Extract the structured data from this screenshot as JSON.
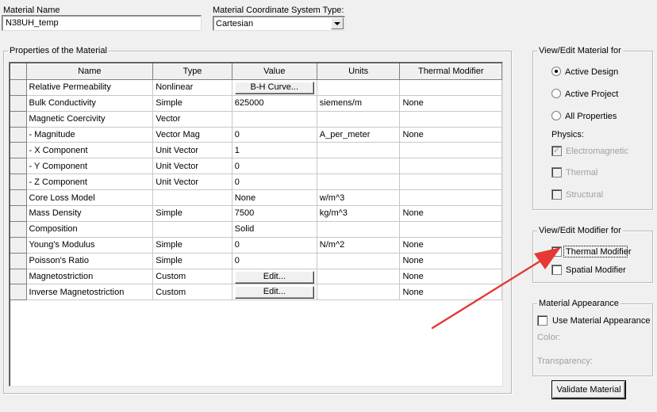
{
  "material_name": {
    "label": "Material Name",
    "value": "N38UH_temp"
  },
  "coord_system": {
    "label": "Material Coordinate System Type:",
    "value": "Cartesian"
  },
  "properties": {
    "title": "Properties of the Material",
    "columns": [
      "Name",
      "Type",
      "Value",
      "Units",
      "Thermal Modifier"
    ],
    "rows": [
      {
        "name": "Relative Permeability",
        "type": "Nonlinear",
        "value": "B-H Curve...",
        "value_is_button": true,
        "units": "",
        "thermal": ""
      },
      {
        "name": "Bulk Conductivity",
        "type": "Simple",
        "value": "625000",
        "value_is_button": false,
        "units": "siemens/m",
        "thermal": "None"
      },
      {
        "name": "Magnetic Coercivity",
        "type": "Vector",
        "value": "",
        "value_is_button": false,
        "units": "",
        "thermal": ""
      },
      {
        "name": "- Magnitude",
        "type": "Vector Mag",
        "value": "0",
        "value_is_button": false,
        "units": "A_per_meter",
        "thermal": "None"
      },
      {
        "name": "- X Component",
        "type": "Unit Vector",
        "value": "1",
        "value_is_button": false,
        "units": "",
        "thermal": ""
      },
      {
        "name": "- Y Component",
        "type": "Unit Vector",
        "value": "0",
        "value_is_button": false,
        "units": "",
        "thermal": ""
      },
      {
        "name": "- Z Component",
        "type": "Unit Vector",
        "value": "0",
        "value_is_button": false,
        "units": "",
        "thermal": ""
      },
      {
        "name": "Core Loss Model",
        "type": "",
        "value": "None",
        "value_is_button": false,
        "units": "w/m^3",
        "thermal": ""
      },
      {
        "name": "Mass Density",
        "type": "Simple",
        "value": "7500",
        "value_is_button": false,
        "units": "kg/m^3",
        "thermal": "None"
      },
      {
        "name": "Composition",
        "type": "",
        "value": "Solid",
        "value_is_button": false,
        "units": "",
        "thermal": ""
      },
      {
        "name": "Young's Modulus",
        "type": "Simple",
        "value": "0",
        "value_is_button": false,
        "units": "N/m^2",
        "thermal": "None"
      },
      {
        "name": "Poisson's Ratio",
        "type": "Simple",
        "value": "0",
        "value_is_button": false,
        "units": "",
        "thermal": "None"
      },
      {
        "name": "Magnetostriction",
        "type": "Custom",
        "value": "Edit...",
        "value_is_button": true,
        "units": "",
        "thermal": "None"
      },
      {
        "name": "Inverse Magnetostriction",
        "type": "Custom",
        "value": "Edit...",
        "value_is_button": true,
        "units": "",
        "thermal": "None"
      }
    ]
  },
  "view_edit_material": {
    "title": "View/Edit Material for",
    "radios": [
      {
        "label": "Active Design",
        "selected": true
      },
      {
        "label": "Active Project",
        "selected": false
      },
      {
        "label": "All Properties",
        "selected": false
      }
    ],
    "physics_label": "Physics:",
    "physics": [
      {
        "label": "Electromagnetic",
        "checked": true
      },
      {
        "label": "Thermal",
        "checked": false
      },
      {
        "label": "Structural",
        "checked": false
      }
    ]
  },
  "view_edit_modifier": {
    "title": "View/Edit Modifier for",
    "thermal_modifier": {
      "label": "Thermal Modifier",
      "checked": true
    },
    "spatial_modifier": {
      "label": "Spatial Modifier",
      "checked": false
    }
  },
  "material_appearance": {
    "title": "Material Appearance",
    "use_label": "Use Material Appearance",
    "use_checked": false,
    "color_label": "Color:",
    "transparency_label": "Transparency:"
  },
  "validate_button": "Validate Material",
  "colors": {
    "annotation_arrow": "#e53935",
    "window_bg": "#f0f0f0"
  }
}
